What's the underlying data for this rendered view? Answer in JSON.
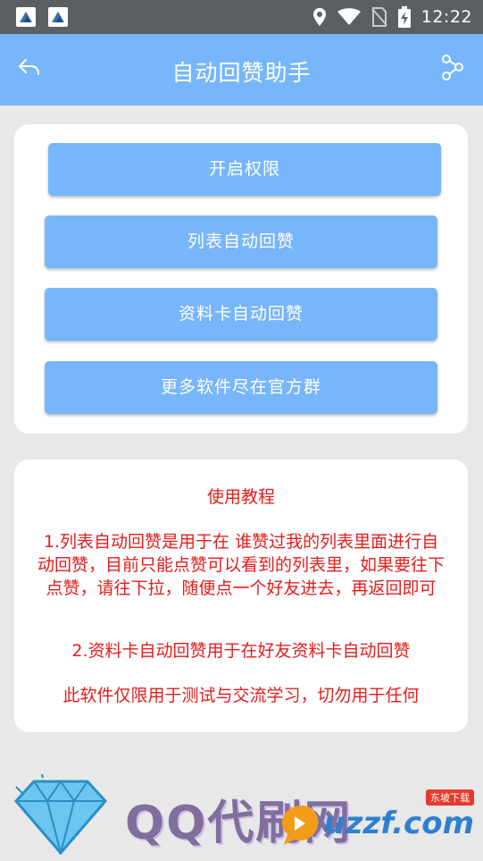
{
  "status_bar": {
    "time": "12:22",
    "icons": [
      "app-notification-icon",
      "app-notification-icon",
      "location-icon",
      "wifi-icon",
      "no-sim-icon",
      "battery-charging-icon"
    ]
  },
  "app_bar": {
    "title": "自动回赞助手",
    "back_icon": "back-arrow-icon",
    "share_icon": "share-icon"
  },
  "actions": {
    "open_permission": "开启权限",
    "list_auto_like": "列表自动回赞",
    "profile_card_auto_like": "资料卡自动回赞",
    "more_software": "更多软件尽在官方群"
  },
  "tutorial": {
    "title": "使用教程",
    "para1": "1.列表自动回赞是用于在 谁赞过我的列表里面进行自动回赞，目前只能点赞可以看到的列表里，如果要往下点赞，请往下拉，随便点一个好友进去，再返回即可",
    "para2": "2.资料卡自动回赞用于在好友资料卡自动回赞",
    "para3": "此软件仅限用于测试与交流学习，切勿用于任何"
  },
  "banner": {
    "text": "QQ代刷网",
    "watermark": "uzzf.com",
    "watermark_small": "东坡下载"
  },
  "colors": {
    "accent": "#77b6fa",
    "status_bar": "#5a5f63",
    "tutorial_text": "#e51c1c",
    "background": "#e8e8e8"
  }
}
